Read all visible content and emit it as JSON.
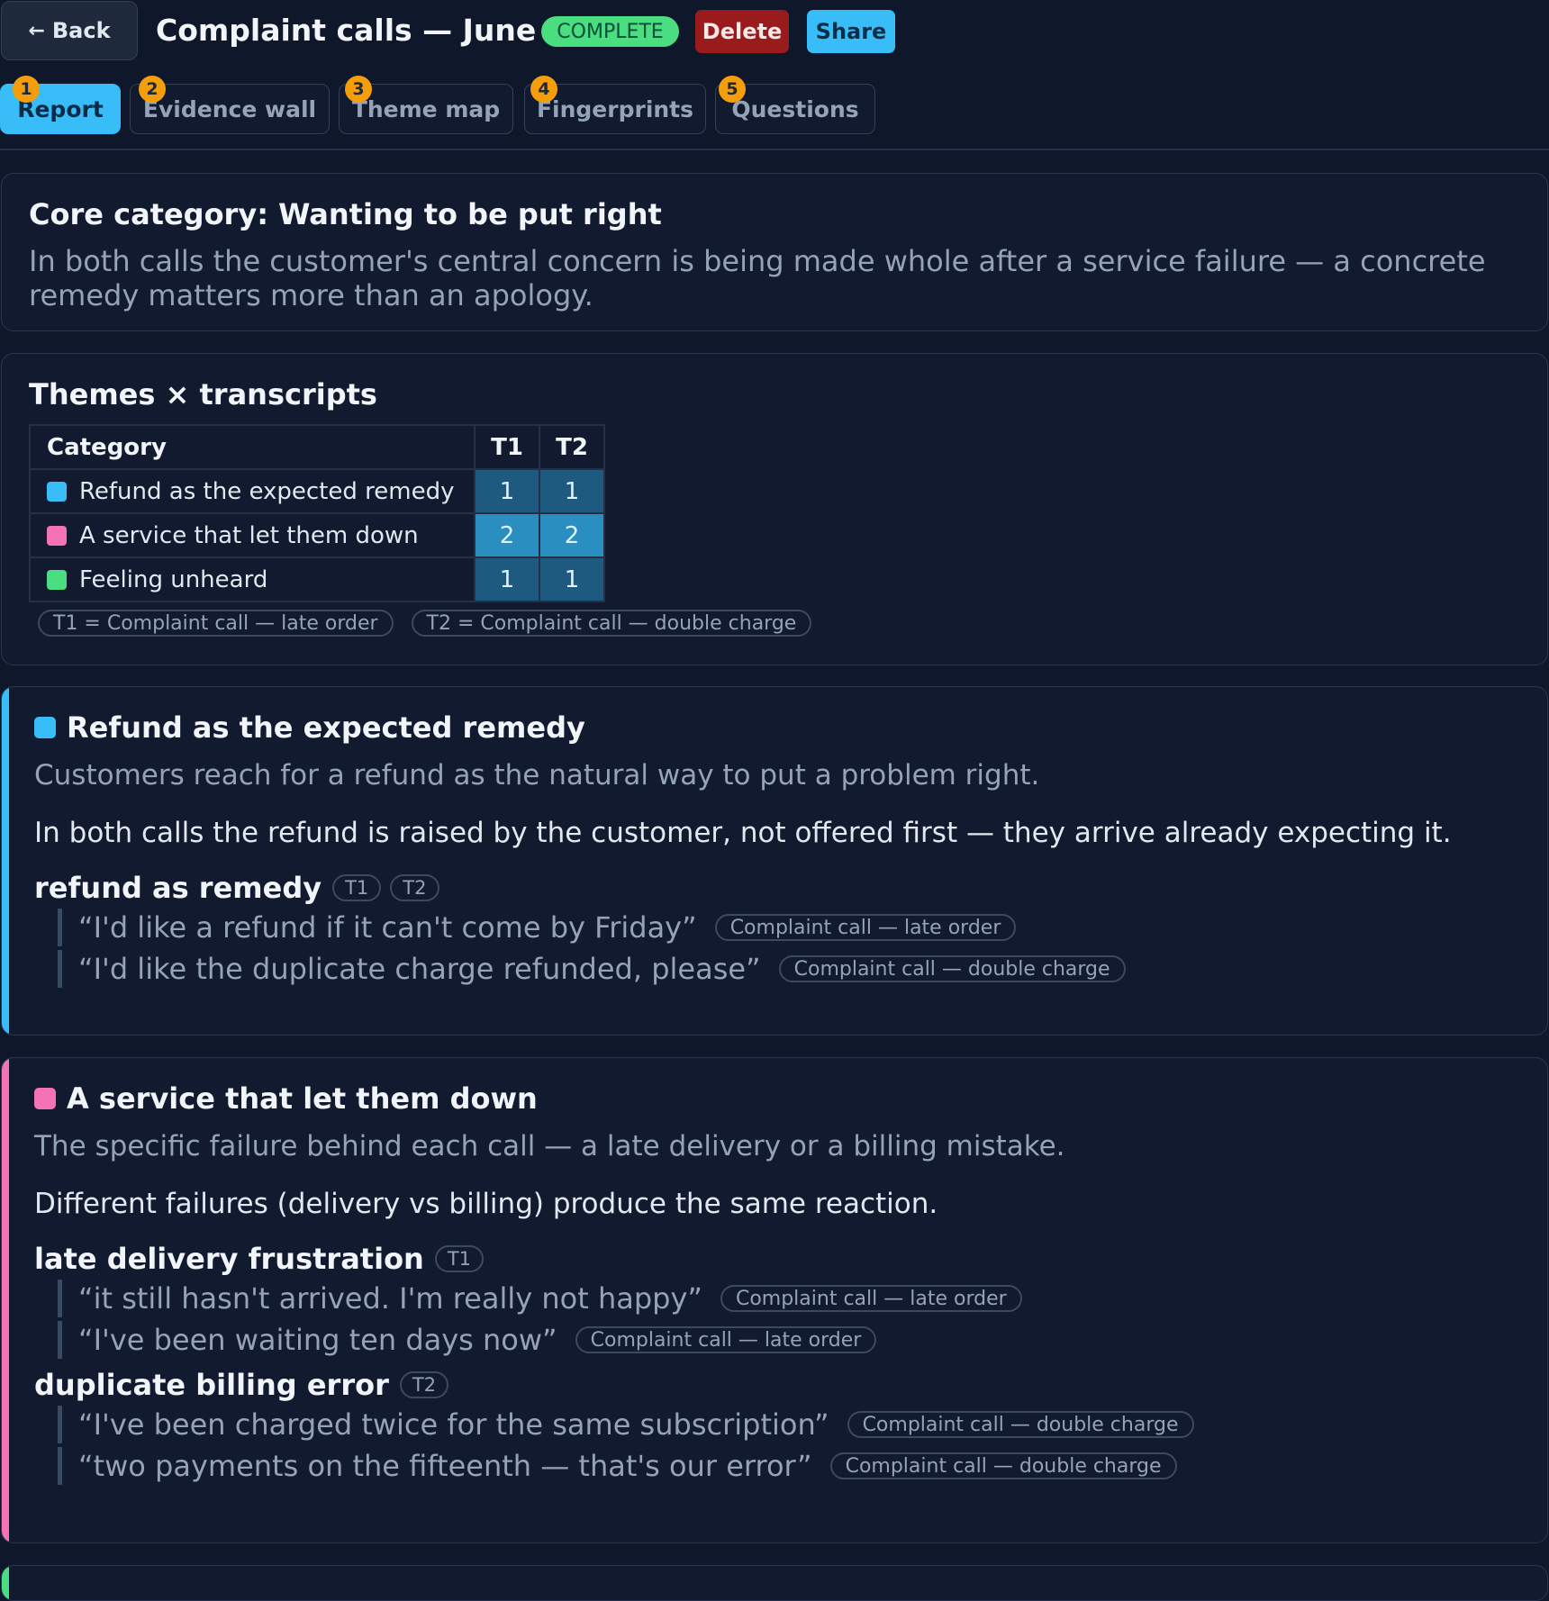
{
  "header": {
    "back_label": "Back",
    "title": "Complaint calls — June",
    "status": "COMPLETE",
    "delete_label": "Delete",
    "share_label": "Share"
  },
  "tabs": [
    {
      "badge": "1",
      "label": "Report",
      "active": true
    },
    {
      "badge": "2",
      "label": "Evidence wall",
      "active": false
    },
    {
      "badge": "3",
      "label": "Theme map",
      "active": false
    },
    {
      "badge": "4",
      "label": "Fingerprints",
      "active": false
    },
    {
      "badge": "5",
      "label": "Questions",
      "active": false
    }
  ],
  "core": {
    "title": "Core category: Wanting to be put right",
    "text": "In both calls the customer's central concern is being made whole after a service failure — a concrete remedy matters more than an apology."
  },
  "matrix": {
    "title": "Themes × transcripts",
    "header_category": "Category",
    "columns": [
      "T1",
      "T2"
    ],
    "rows": [
      {
        "label": "Refund as the expected remedy",
        "color": "#38bdf8",
        "counts": [
          "1",
          "1"
        ]
      },
      {
        "label": "A service that let them down",
        "color": "#f472b6",
        "counts": [
          "2",
          "2"
        ]
      },
      {
        "label": "Feeling unheard",
        "color": "#4ade80",
        "counts": [
          "1",
          "1"
        ]
      }
    ],
    "legend": [
      "T1 = Complaint call — late order",
      "T2 = Complaint call — double charge"
    ]
  },
  "themes": [
    {
      "title": "Refund as the expected remedy",
      "color": "#38bdf8",
      "description": "Customers reach for a refund as the natural way to put a problem right.",
      "insight": "In both calls the refund is raised by the customer, not offered first — they arrive already expecting it.",
      "codes": [
        {
          "name": "refund as remedy",
          "transcripts": [
            "T1",
            "T2"
          ],
          "quotes": [
            {
              "text": "“I'd like a refund if it can't come by Friday”",
              "source": "Complaint call — late order"
            },
            {
              "text": "“I'd like the duplicate charge refunded, please”",
              "source": "Complaint call — double charge"
            }
          ]
        }
      ]
    },
    {
      "title": "A service that let them down",
      "color": "#f472b6",
      "description": "The specific failure behind each call — a late delivery or a billing mistake.",
      "insight": "Different failures (delivery vs billing) produce the same reaction.",
      "codes": [
        {
          "name": "late delivery frustration",
          "transcripts": [
            "T1"
          ],
          "quotes": [
            {
              "text": "“it still hasn't arrived. I'm really not happy”",
              "source": "Complaint call — late order"
            },
            {
              "text": "“I've been waiting ten days now”",
              "source": "Complaint call — late order"
            }
          ]
        },
        {
          "name": "duplicate billing error",
          "transcripts": [
            "T2"
          ],
          "quotes": [
            {
              "text": "“I've been charged twice for the same subscription”",
              "source": "Complaint call — double charge"
            },
            {
              "text": "“two payments on the fifteenth — that's our error”",
              "source": "Complaint call — double charge"
            }
          ]
        }
      ]
    }
  ]
}
